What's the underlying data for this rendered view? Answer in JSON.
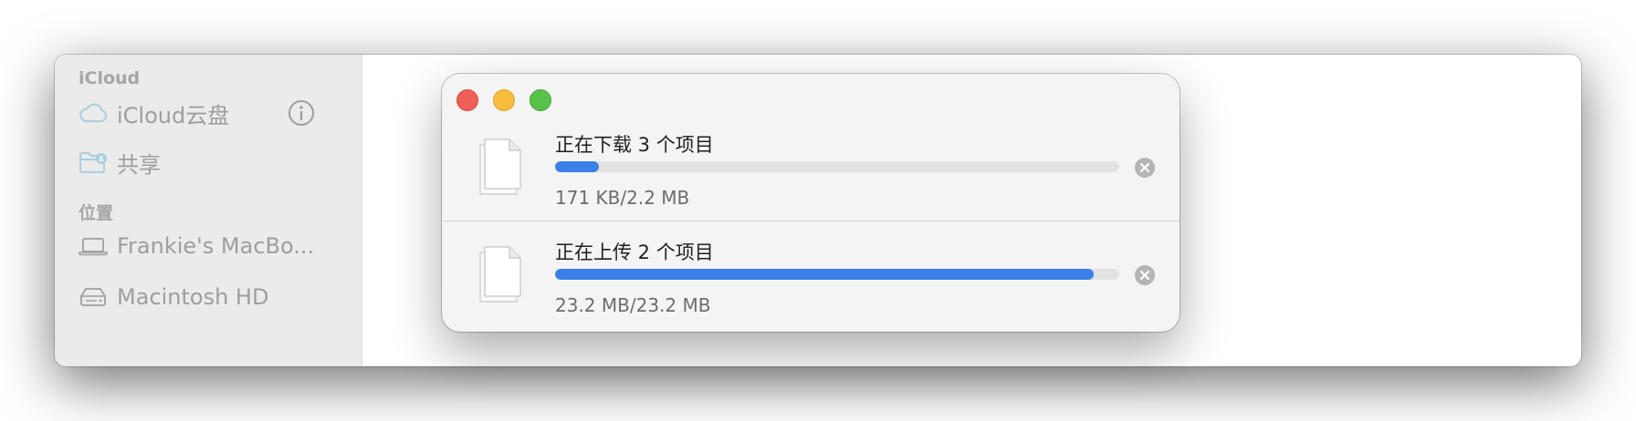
{
  "sidebar": {
    "sections": [
      {
        "title": "iCloud",
        "items": [
          {
            "label": "iCloud云盘",
            "icon": "cloud-icon"
          },
          {
            "label": "共享",
            "icon": "shared-folder-icon"
          }
        ]
      },
      {
        "title": "位置",
        "items": [
          {
            "label": "Frankie's MacBo...",
            "icon": "laptop-icon"
          },
          {
            "label": "Macintosh HD",
            "icon": "hard-drive-icon"
          }
        ]
      }
    ],
    "info_icon": "info-icon"
  },
  "progress_window": {
    "window_controls": [
      "close",
      "minimize",
      "zoom"
    ],
    "transfers": [
      {
        "title": "正在下载 3 个项目",
        "size": "171 KB/2.2 MB",
        "progress": 0.077,
        "icon": "document-stack-icon"
      },
      {
        "title": "正在上传 2 个项目",
        "size": "23.2 MB/23.2 MB",
        "progress": 0.955,
        "icon": "document-stack-icon"
      }
    ]
  },
  "colors": {
    "accent": "#3a80e7",
    "close": "#ee5f57",
    "minimize": "#f7bd3e",
    "zoom": "#5ac24b",
    "sidebar_icon": "#a8cfe0",
    "cancel_icon": "#b5b5b5"
  }
}
